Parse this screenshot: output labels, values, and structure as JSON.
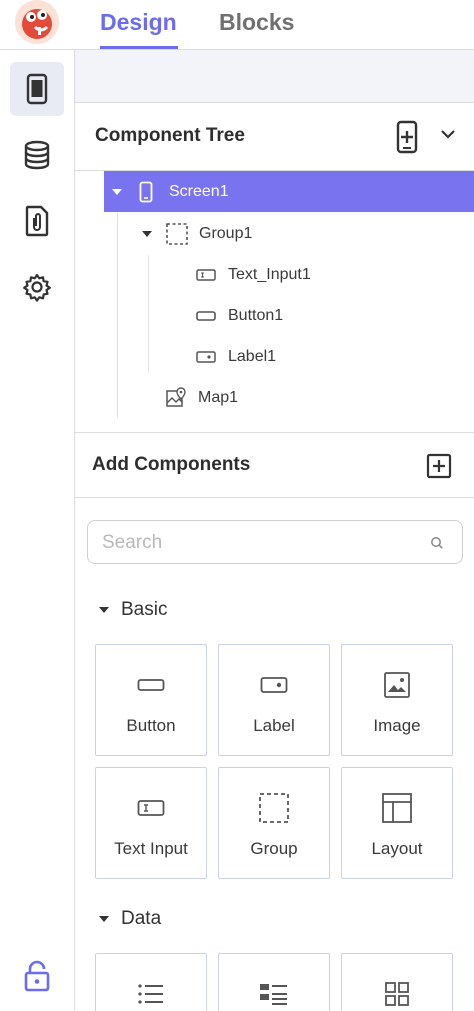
{
  "header": {
    "tabs": [
      {
        "label": "Design",
        "active": true
      },
      {
        "label": "Blocks",
        "active": false
      }
    ]
  },
  "rail": {
    "items": [
      {
        "icon": "phone-icon",
        "active": true
      },
      {
        "icon": "database-icon",
        "active": false
      },
      {
        "icon": "paperclip-file-icon",
        "active": false
      },
      {
        "icon": "gear-icon",
        "active": false
      }
    ],
    "bottom_icon": "lock-icon"
  },
  "component_tree": {
    "title": "Component Tree",
    "nodes": [
      {
        "label": "Screen1",
        "icon": "phone-icon",
        "selected": true
      },
      {
        "label": "Group1",
        "icon": "group-icon"
      },
      {
        "label": "Text_Input1",
        "icon": "text-input-icon"
      },
      {
        "label": "Button1",
        "icon": "button-icon"
      },
      {
        "label": "Label1",
        "icon": "label-icon"
      },
      {
        "label": "Map1",
        "icon": "map-icon"
      }
    ]
  },
  "add_components": {
    "title": "Add Components",
    "search_placeholder": "Search",
    "categories": [
      {
        "label": "Basic",
        "items": [
          {
            "label": "Button",
            "icon": "button-icon"
          },
          {
            "label": "Label",
            "icon": "label-icon"
          },
          {
            "label": "Image",
            "icon": "image-icon"
          },
          {
            "label": "Text Input",
            "icon": "text-input-icon"
          },
          {
            "label": "Group",
            "icon": "group-icon"
          },
          {
            "label": "Layout",
            "icon": "layout-icon"
          }
        ]
      },
      {
        "label": "Data",
        "items": [
          {
            "label": "",
            "icon": "list-icon"
          },
          {
            "label": "",
            "icon": "form-list-icon"
          },
          {
            "label": "",
            "icon": "grid-icon"
          }
        ]
      }
    ]
  },
  "colors": {
    "accent": "#6b6cf0",
    "selected_row": "#7a73ef",
    "rail_active": "#e9ebf4"
  }
}
